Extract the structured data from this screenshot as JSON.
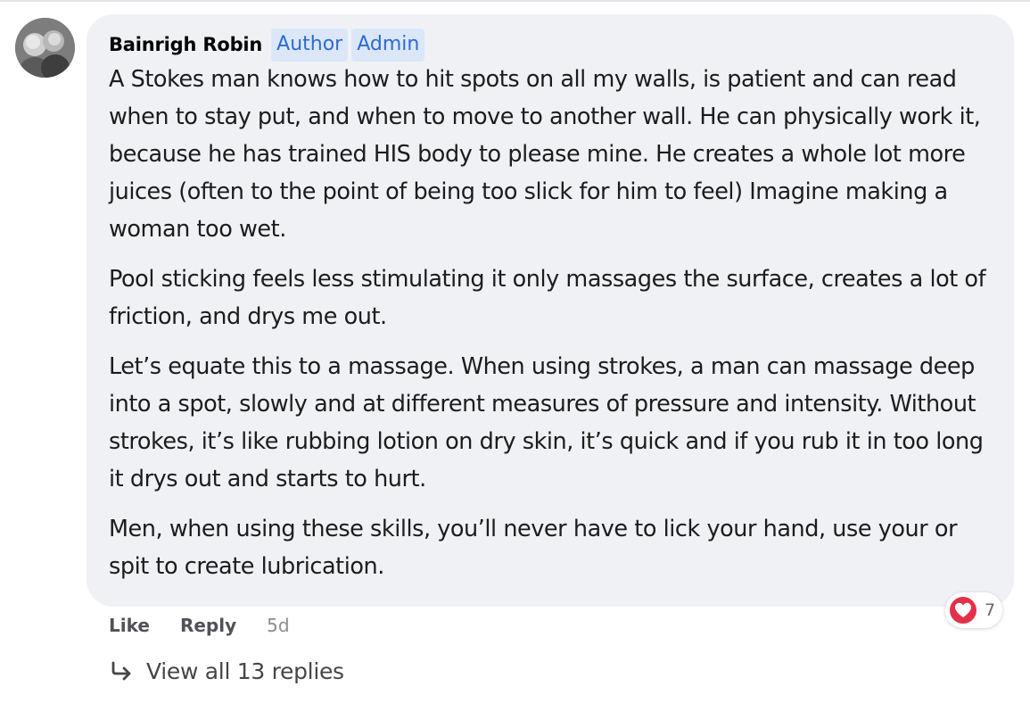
{
  "comment": {
    "author": "Bainrigh Robin",
    "badges": [
      "Author",
      "Admin"
    ],
    "paragraphs": [
      "A Stokes man knows how to hit spots on all my walls, is patient and can read when to stay put, and when to move to another wall. He can physically work it, because he has trained HIS body to please mine. He creates a whole lot more juices (often to the point of being too slick for him to feel) Imagine making a woman too wet.",
      "Pool sticking feels less stimulating it only massages the surface, creates a lot of friction, and drys me out.",
      "Let’s equate this to a massage. When using strokes, a man can massage deep into a spot, slowly and at different measures of pressure and intensity. Without strokes, it’s like rubbing lotion on dry skin, it’s quick and if you rub it in too long it drys out and starts to hurt.",
      "Men, when using these skills, you’ll never have to lick your hand, use your or spit to create lubrication."
    ],
    "reactions": {
      "icon": "heart-icon",
      "count": "7",
      "color": "#e4304a"
    },
    "actions": {
      "like": "Like",
      "reply": "Reply",
      "timestamp": "5d"
    },
    "view_replies": {
      "icon": "reply-arrow-icon",
      "label": "View all 13 replies"
    }
  },
  "colors": {
    "bubble": "#eff1f4",
    "badge_bg": "#dbe7f8",
    "badge_text": "#2d6ad6"
  }
}
